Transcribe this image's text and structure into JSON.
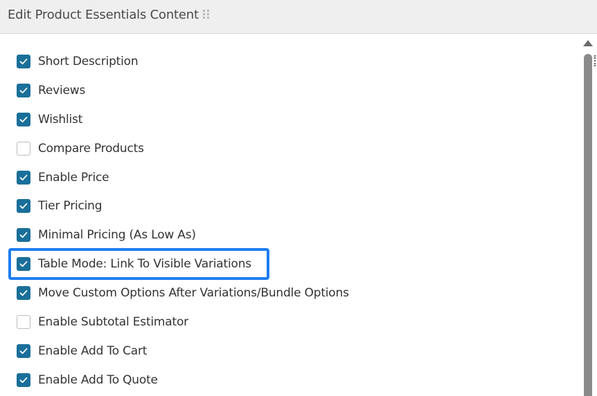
{
  "dialog": {
    "title": "Edit Product Essentials Content"
  },
  "icons": {
    "drag_handle": "drag-handle-icon",
    "check": "checkmark-icon",
    "scroll_up": "scroll-up-arrow-icon"
  },
  "colors": {
    "checkbox_checked": "#1a6f9a",
    "highlight_border": "#1e7df0",
    "header_background": "#efefef"
  },
  "options": [
    {
      "label": "Short Description",
      "checked": true
    },
    {
      "label": "Reviews",
      "checked": true
    },
    {
      "label": "Wishlist",
      "checked": true
    },
    {
      "label": "Compare Products",
      "checked": false
    },
    {
      "label": "Enable Price",
      "checked": true
    },
    {
      "label": "Tier Pricing",
      "checked": true
    },
    {
      "label": "Minimal Pricing (As Low As)",
      "checked": true
    },
    {
      "label": "Table Mode: Link To Visible Variations",
      "checked": true,
      "highlighted": true
    },
    {
      "label": "Move Custom Options After Variations/Bundle Options",
      "checked": true
    },
    {
      "label": "Enable Subtotal Estimator",
      "checked": false
    },
    {
      "label": "Enable Add To Cart",
      "checked": true
    },
    {
      "label": "Enable Add To Quote",
      "checked": true
    }
  ]
}
